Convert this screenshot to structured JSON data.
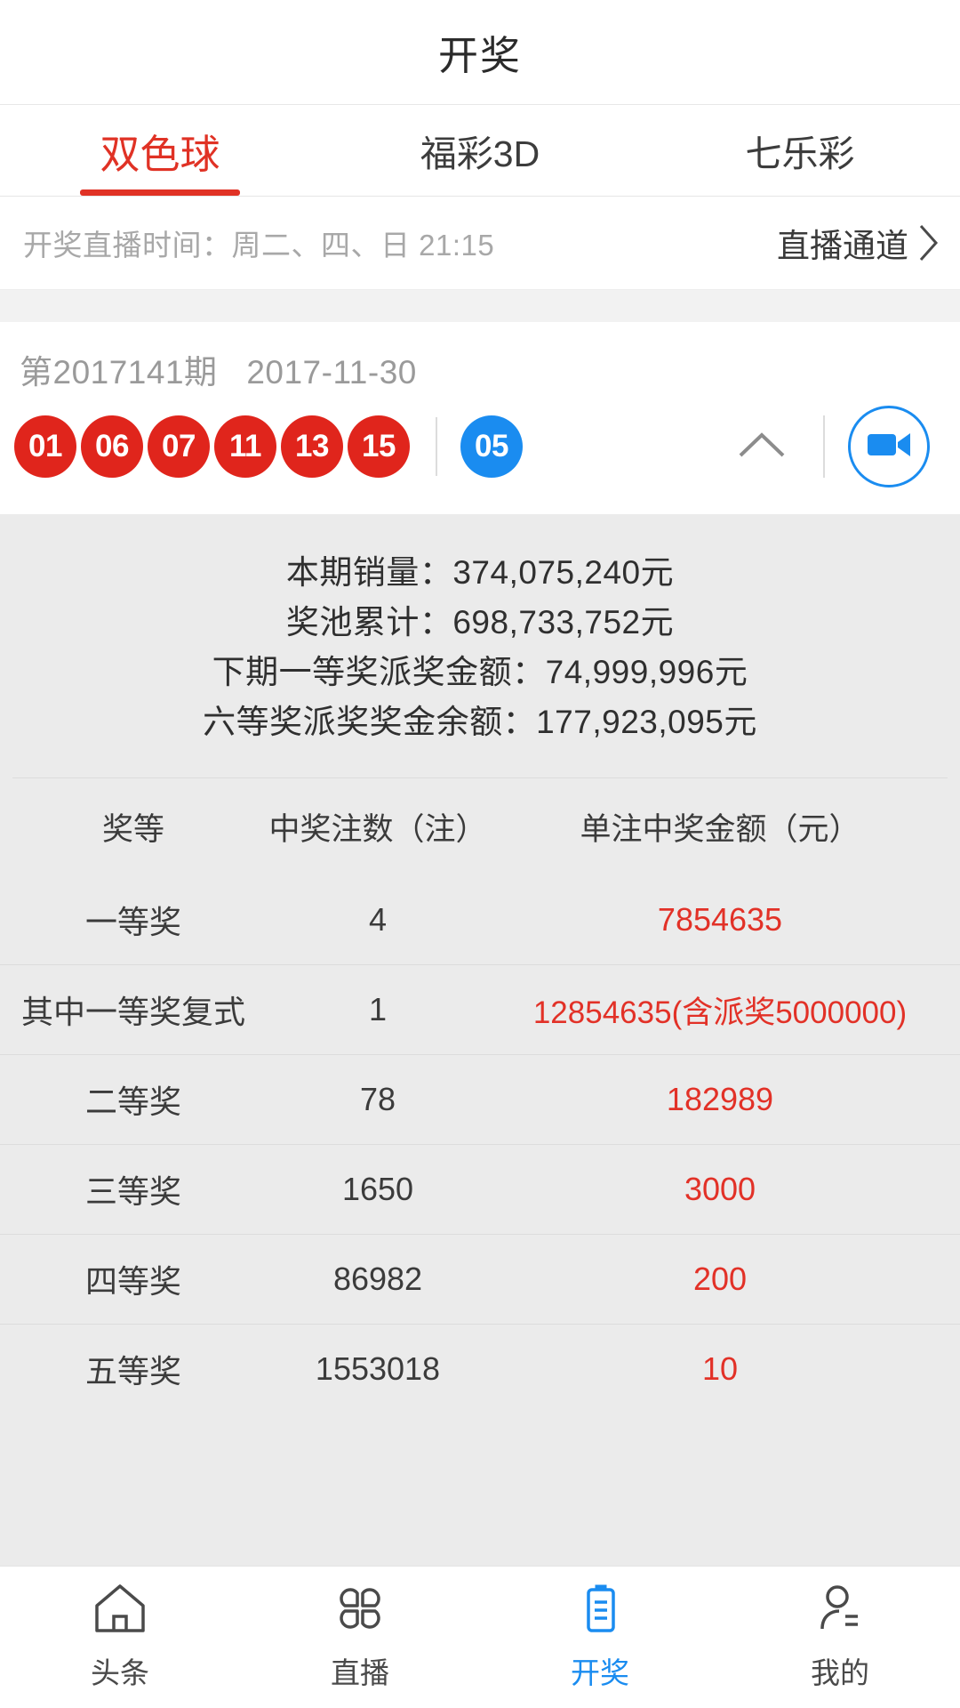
{
  "header": {
    "title": "开奖"
  },
  "tabs": [
    {
      "label": "双色球",
      "active": true
    },
    {
      "label": "福彩3D",
      "active": false
    },
    {
      "label": "七乐彩",
      "active": false
    }
  ],
  "live_bar": {
    "schedule_text": "开奖直播时间：周二、四、日 21:15",
    "channel_label": "直播通道",
    "chevron_icon": "chevron-right-icon"
  },
  "draw": {
    "period": "第2017141期",
    "date": "2017-11-30",
    "red_balls": [
      "01",
      "06",
      "07",
      "11",
      "13",
      "15"
    ],
    "blue_balls": [
      "05"
    ],
    "collapse_icon": "chevron-up-icon",
    "video_icon": "video-camera-icon",
    "red_color": "#e0251c",
    "blue_color": "#1a8cf0"
  },
  "summary": [
    "本期销量：374,075,240元",
    "奖池累计：698,733,752元",
    "下期一等奖派奖金额：74,999,996元",
    "六等奖派奖奖金余额：177,923,095元"
  ],
  "prize_table": {
    "columns": [
      "奖等",
      "中奖注数（注）",
      "单注中奖金额（元）"
    ],
    "rows": [
      {
        "level": "一等奖",
        "count": "4",
        "amount": "7854635"
      },
      {
        "level": "其中一等奖复式",
        "count": "1",
        "amount": "12854635(含派奖5000000)"
      },
      {
        "level": "二等奖",
        "count": "78",
        "amount": "182989"
      },
      {
        "level": "三等奖",
        "count": "1650",
        "amount": "3000"
      },
      {
        "level": "四等奖",
        "count": "86982",
        "amount": "200"
      },
      {
        "level": "五等奖",
        "count": "1553018",
        "amount": "10"
      }
    ],
    "amount_color": "#e23127"
  },
  "bottom_nav": [
    {
      "label": "头条",
      "icon": "home-icon",
      "active": false
    },
    {
      "label": "直播",
      "icon": "grid-clover-icon",
      "active": false
    },
    {
      "label": "开奖",
      "icon": "clipboard-icon",
      "active": true
    },
    {
      "label": "我的",
      "icon": "person-icon",
      "active": false
    }
  ],
  "theme": {
    "accent_red": "#e03225",
    "accent_blue": "#1a8cf0",
    "panel_bg": "#ebebeb"
  }
}
